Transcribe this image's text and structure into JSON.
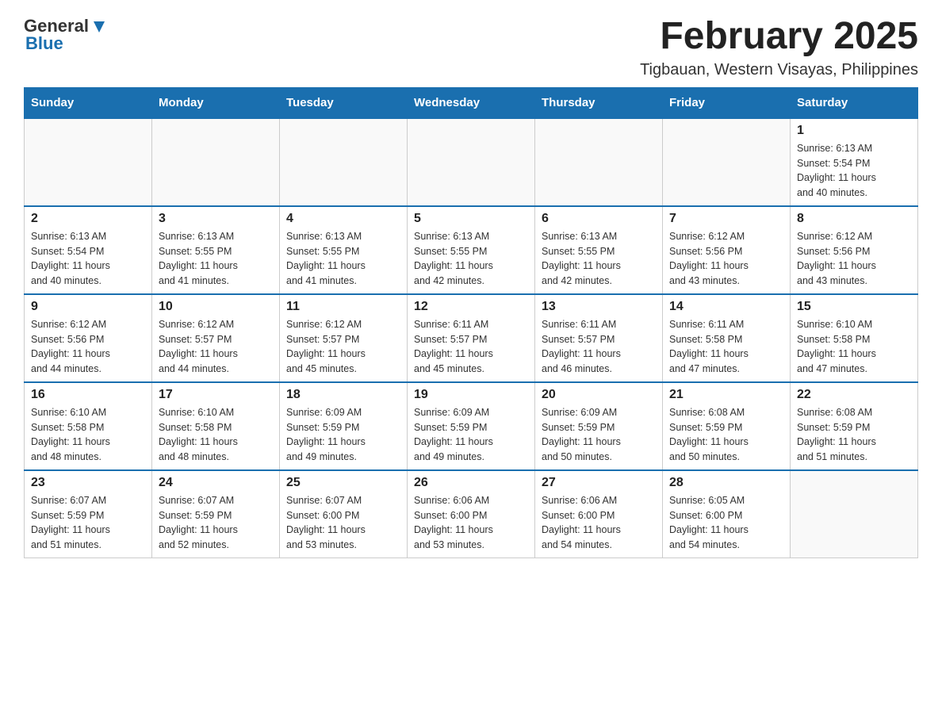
{
  "header": {
    "logo_general": "General",
    "logo_blue": "Blue",
    "month_title": "February 2025",
    "location": "Tigbauan, Western Visayas, Philippines"
  },
  "weekdays": [
    "Sunday",
    "Monday",
    "Tuesday",
    "Wednesday",
    "Thursday",
    "Friday",
    "Saturday"
  ],
  "weeks": [
    {
      "days": [
        {
          "num": "",
          "info": ""
        },
        {
          "num": "",
          "info": ""
        },
        {
          "num": "",
          "info": ""
        },
        {
          "num": "",
          "info": ""
        },
        {
          "num": "",
          "info": ""
        },
        {
          "num": "",
          "info": ""
        },
        {
          "num": "1",
          "info": "Sunrise: 6:13 AM\nSunset: 5:54 PM\nDaylight: 11 hours\nand 40 minutes."
        }
      ]
    },
    {
      "days": [
        {
          "num": "2",
          "info": "Sunrise: 6:13 AM\nSunset: 5:54 PM\nDaylight: 11 hours\nand 40 minutes."
        },
        {
          "num": "3",
          "info": "Sunrise: 6:13 AM\nSunset: 5:55 PM\nDaylight: 11 hours\nand 41 minutes."
        },
        {
          "num": "4",
          "info": "Sunrise: 6:13 AM\nSunset: 5:55 PM\nDaylight: 11 hours\nand 41 minutes."
        },
        {
          "num": "5",
          "info": "Sunrise: 6:13 AM\nSunset: 5:55 PM\nDaylight: 11 hours\nand 42 minutes."
        },
        {
          "num": "6",
          "info": "Sunrise: 6:13 AM\nSunset: 5:55 PM\nDaylight: 11 hours\nand 42 minutes."
        },
        {
          "num": "7",
          "info": "Sunrise: 6:12 AM\nSunset: 5:56 PM\nDaylight: 11 hours\nand 43 minutes."
        },
        {
          "num": "8",
          "info": "Sunrise: 6:12 AM\nSunset: 5:56 PM\nDaylight: 11 hours\nand 43 minutes."
        }
      ]
    },
    {
      "days": [
        {
          "num": "9",
          "info": "Sunrise: 6:12 AM\nSunset: 5:56 PM\nDaylight: 11 hours\nand 44 minutes."
        },
        {
          "num": "10",
          "info": "Sunrise: 6:12 AM\nSunset: 5:57 PM\nDaylight: 11 hours\nand 44 minutes."
        },
        {
          "num": "11",
          "info": "Sunrise: 6:12 AM\nSunset: 5:57 PM\nDaylight: 11 hours\nand 45 minutes."
        },
        {
          "num": "12",
          "info": "Sunrise: 6:11 AM\nSunset: 5:57 PM\nDaylight: 11 hours\nand 45 minutes."
        },
        {
          "num": "13",
          "info": "Sunrise: 6:11 AM\nSunset: 5:57 PM\nDaylight: 11 hours\nand 46 minutes."
        },
        {
          "num": "14",
          "info": "Sunrise: 6:11 AM\nSunset: 5:58 PM\nDaylight: 11 hours\nand 47 minutes."
        },
        {
          "num": "15",
          "info": "Sunrise: 6:10 AM\nSunset: 5:58 PM\nDaylight: 11 hours\nand 47 minutes."
        }
      ]
    },
    {
      "days": [
        {
          "num": "16",
          "info": "Sunrise: 6:10 AM\nSunset: 5:58 PM\nDaylight: 11 hours\nand 48 minutes."
        },
        {
          "num": "17",
          "info": "Sunrise: 6:10 AM\nSunset: 5:58 PM\nDaylight: 11 hours\nand 48 minutes."
        },
        {
          "num": "18",
          "info": "Sunrise: 6:09 AM\nSunset: 5:59 PM\nDaylight: 11 hours\nand 49 minutes."
        },
        {
          "num": "19",
          "info": "Sunrise: 6:09 AM\nSunset: 5:59 PM\nDaylight: 11 hours\nand 49 minutes."
        },
        {
          "num": "20",
          "info": "Sunrise: 6:09 AM\nSunset: 5:59 PM\nDaylight: 11 hours\nand 50 minutes."
        },
        {
          "num": "21",
          "info": "Sunrise: 6:08 AM\nSunset: 5:59 PM\nDaylight: 11 hours\nand 50 minutes."
        },
        {
          "num": "22",
          "info": "Sunrise: 6:08 AM\nSunset: 5:59 PM\nDaylight: 11 hours\nand 51 minutes."
        }
      ]
    },
    {
      "days": [
        {
          "num": "23",
          "info": "Sunrise: 6:07 AM\nSunset: 5:59 PM\nDaylight: 11 hours\nand 51 minutes."
        },
        {
          "num": "24",
          "info": "Sunrise: 6:07 AM\nSunset: 5:59 PM\nDaylight: 11 hours\nand 52 minutes."
        },
        {
          "num": "25",
          "info": "Sunrise: 6:07 AM\nSunset: 6:00 PM\nDaylight: 11 hours\nand 53 minutes."
        },
        {
          "num": "26",
          "info": "Sunrise: 6:06 AM\nSunset: 6:00 PM\nDaylight: 11 hours\nand 53 minutes."
        },
        {
          "num": "27",
          "info": "Sunrise: 6:06 AM\nSunset: 6:00 PM\nDaylight: 11 hours\nand 54 minutes."
        },
        {
          "num": "28",
          "info": "Sunrise: 6:05 AM\nSunset: 6:00 PM\nDaylight: 11 hours\nand 54 minutes."
        },
        {
          "num": "",
          "info": ""
        }
      ]
    }
  ],
  "colors": {
    "header_bg": "#1a6faf",
    "header_text": "#ffffff",
    "border": "#cccccc",
    "day_number": "#222222",
    "day_info": "#333333"
  }
}
